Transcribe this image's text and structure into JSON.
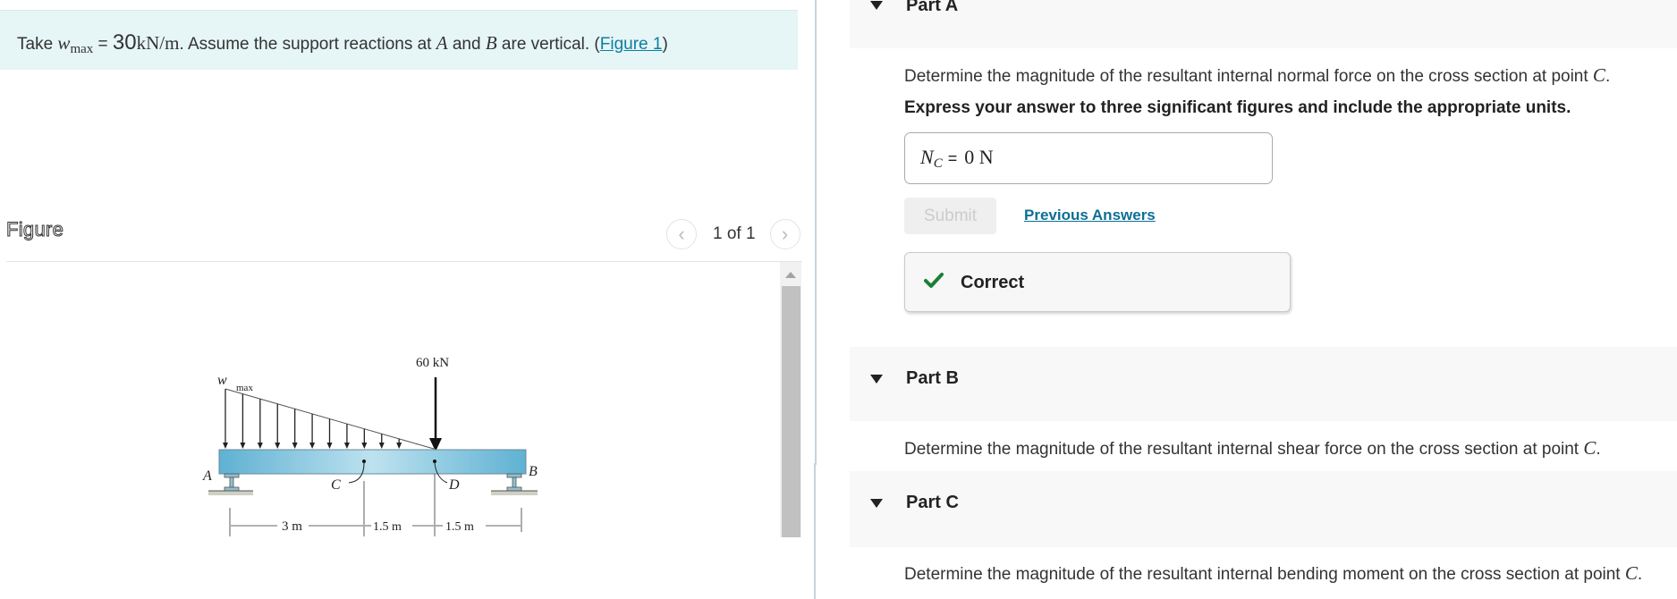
{
  "intro": {
    "prefix": "Take ",
    "var": "w",
    "var_sub": "max",
    "equals": " = ",
    "value": "30",
    "unit": "kN/m",
    "text_after_unit": ". Assume the support reactions at ",
    "point_a": "A",
    "and": " and ",
    "point_b": "B",
    "text_end": " are vertical. (",
    "figure_link": "Figure 1",
    "close_paren": ")"
  },
  "figure": {
    "header": "Figure",
    "counter": "1 of 1",
    "prev_icon": "chevron-left-icon",
    "next_icon": "chevron-right-icon",
    "diagram": {
      "load_label": "60 kN",
      "dist_load_label_w": "w",
      "dist_load_label_sub": "max",
      "support_a": "A",
      "support_b": "B",
      "point_c": "C",
      "point_d": "D",
      "dims": [
        "3 m",
        "1.5 m",
        "1.5 m"
      ],
      "beam_color": "#7ec3dc"
    }
  },
  "parts": [
    {
      "label": "Part A",
      "question_prefix": "Determine the magnitude of the resultant internal normal force on the cross section at point ",
      "point": "C",
      "question_suffix": ".",
      "instructions": "Express your answer to three significant figures and include the appropriate units.",
      "answer": {
        "var": "N",
        "var_sub": "C",
        "equals": "=",
        "value": "0 N"
      },
      "submit_label": "Submit",
      "previous_answers_label": "Previous Answers",
      "feedback": "Correct",
      "feedback_color": "#1a7f37"
    },
    {
      "label": "Part B",
      "question_prefix": "Determine the magnitude of the resultant internal shear force on the cross section at point ",
      "point": "C",
      "question_suffix": "."
    },
    {
      "label": "Part C",
      "question_prefix": "Determine the magnitude of the resultant internal bending moment on the cross section at point ",
      "point": "C",
      "question_suffix": "."
    }
  ]
}
